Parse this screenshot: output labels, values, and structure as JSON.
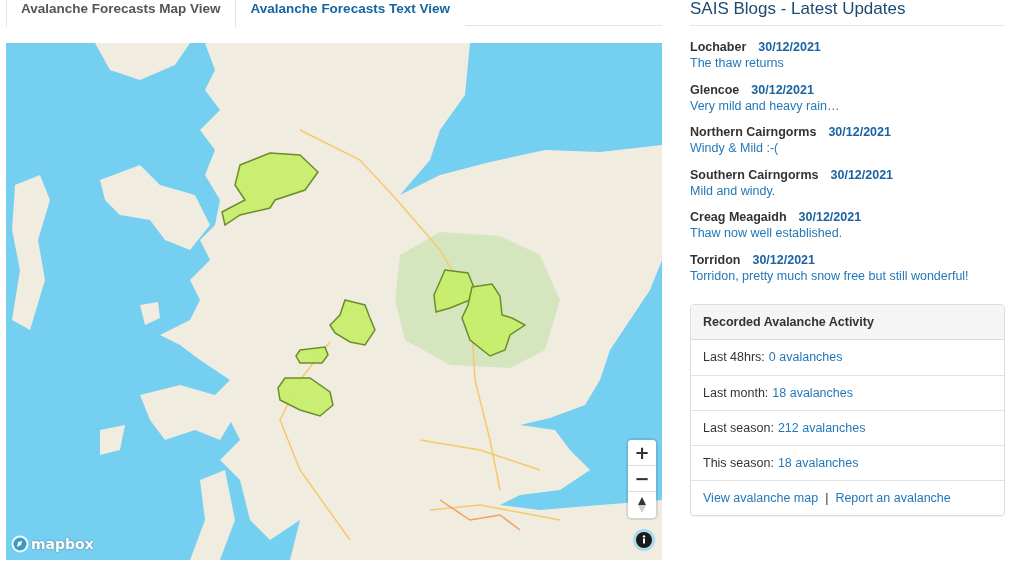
{
  "tabs": [
    {
      "label": "Avalanche Forecasts Map View",
      "selected": true
    },
    {
      "label": "Avalanche Forecasts Text View",
      "selected": false
    }
  ],
  "map": {
    "zoom_controls": [
      "+",
      "−"
    ],
    "attribution": "mapbox"
  },
  "blogs": {
    "title": "SAIS Blogs - Latest Updates",
    "posts": [
      {
        "area": "Lochaber",
        "date": "30/12/2021",
        "summary": "The thaw returns"
      },
      {
        "area": "Glencoe",
        "date": "30/12/2021",
        "summary": "Very mild and heavy rain…"
      },
      {
        "area": "Northern Cairngorms",
        "date": "30/12/2021",
        "summary": "Windy & Mild :-("
      },
      {
        "area": "Southern Cairngorms",
        "date": "30/12/2021",
        "summary": "Mild and windy."
      },
      {
        "area": "Creag Meagaidh",
        "date": "30/12/2021",
        "summary": "Thaw now well established."
      },
      {
        "area": "Torridon",
        "date": "30/12/2021",
        "summary": "Torridon, pretty much snow free but still wonderful!"
      }
    ]
  },
  "activity": {
    "title": "Recorded Avalanche Activity",
    "rows": [
      {
        "label": "Last 48hrs:",
        "link": "0 avalanches"
      },
      {
        "label": "Last month:",
        "link": "18 avalanches"
      },
      {
        "label": "Last season:",
        "link": "212 avalanches"
      },
      {
        "label": "This season:",
        "link": "18 avalanches"
      }
    ],
    "links": [
      "View avalanche map",
      "Report an avalanche"
    ],
    "separator": "|"
  }
}
